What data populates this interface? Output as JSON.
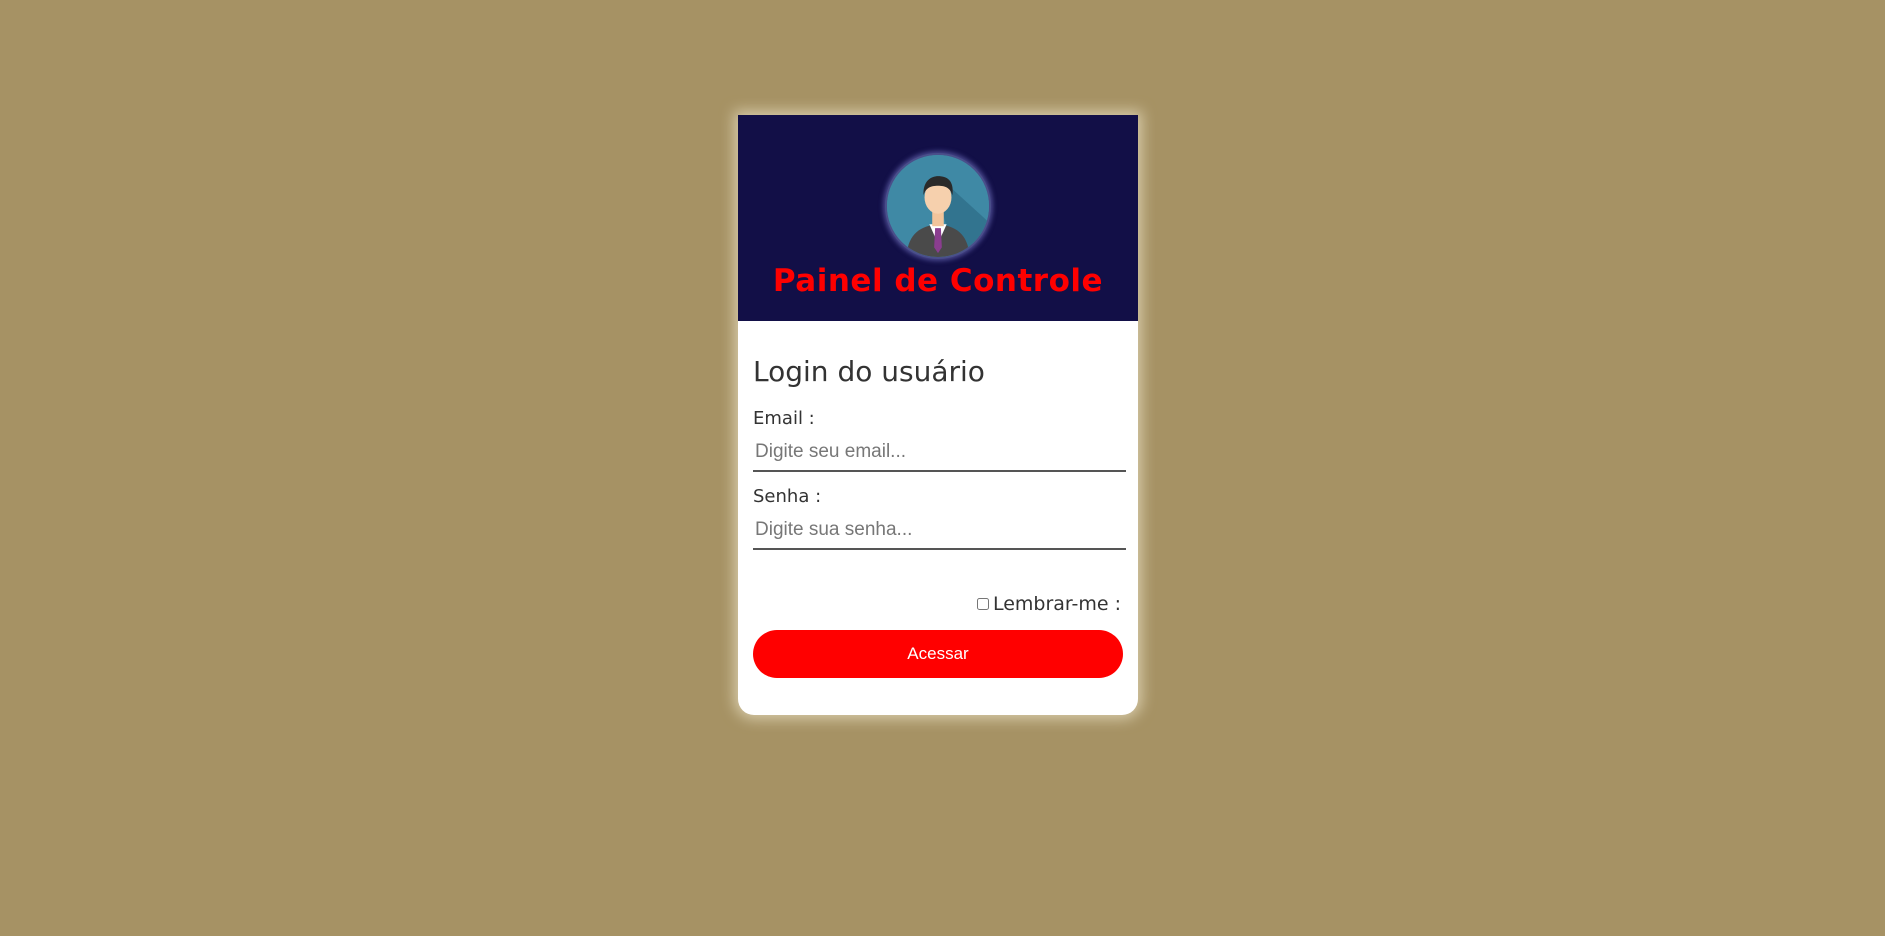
{
  "header": {
    "title": "Painel de Controle",
    "avatar_icon": "user-avatar-icon"
  },
  "form": {
    "heading": "Login do usuário",
    "email": {
      "label": "Email :",
      "placeholder": "Digite seu email...",
      "value": ""
    },
    "password": {
      "label": "Senha :",
      "placeholder": "Digite sua senha...",
      "value": ""
    },
    "remember": {
      "label": "Lembrar-me :",
      "checked": false
    },
    "submit_label": "Acessar"
  },
  "colors": {
    "page_background": "#a69264",
    "header_background": "#120f47",
    "accent": "#ff0000",
    "card_background": "#ffffff"
  }
}
